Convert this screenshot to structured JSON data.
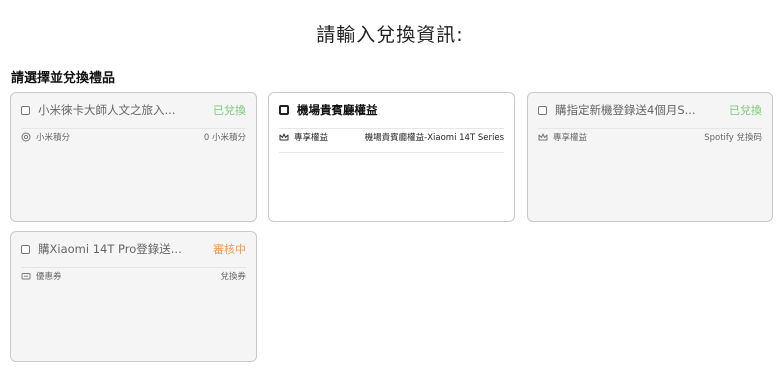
{
  "page_title": "請輸入兌換資訊:",
  "section_title": "請選擇並兌換禮品",
  "cards": [
    {
      "title": "小米徠卡大師人文之旅入...",
      "status": "已兌換",
      "row_icon": "coin-icon",
      "row_label": "小米積分",
      "row_value": "0 小米積分"
    },
    {
      "title": "機場貴賓廳權益",
      "status": "",
      "row_icon": "crown-icon",
      "row_label": "專享權益",
      "row_value": "機場貴賓廳權益-Xiaomi 14T Series"
    },
    {
      "title": "購指定新機登錄送4個月S...",
      "status": "已兌換",
      "row_icon": "crown-icon",
      "row_label": "專享權益",
      "row_value": "Spotify 兌換码"
    },
    {
      "title": "購Xiaomi 14T Pro登錄送...",
      "status": "審核中",
      "row_icon": "ticket-icon",
      "row_label": "優惠券",
      "row_value": "兌換券"
    }
  ],
  "colors": {
    "redeemed": "#7bc97b",
    "pending": "#f2994a"
  }
}
